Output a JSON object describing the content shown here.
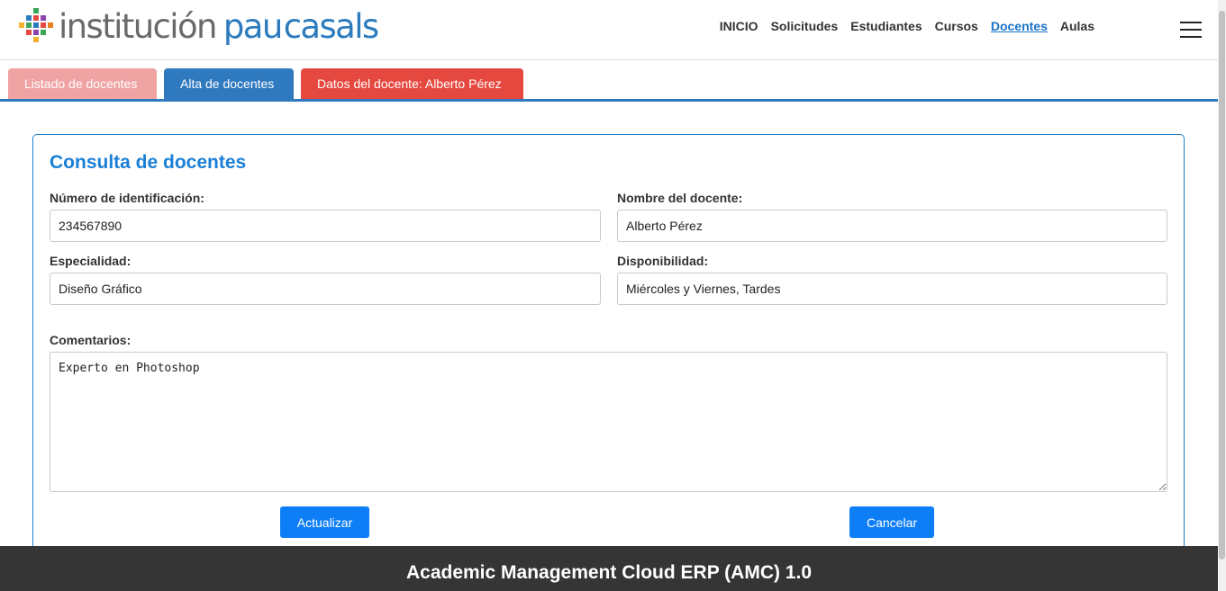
{
  "brand": {
    "word1": "institución",
    "word2": "pau",
    "word3": "casals",
    "mark_colors": [
      "#e5483f",
      "#f2b230",
      "#3aa757",
      "#2b7bbd",
      "#8e44ad",
      "#e67e22"
    ]
  },
  "nav": {
    "items": [
      {
        "label": "INICIO"
      },
      {
        "label": "Solicitudes"
      },
      {
        "label": "Estudiantes"
      },
      {
        "label": "Cursos"
      },
      {
        "label": "Docentes",
        "active": true
      },
      {
        "label": "Aulas"
      }
    ],
    "menu_icon": "hamburger-icon"
  },
  "tabs": [
    {
      "label": "Listado de docentes"
    },
    {
      "label": "Alta de docentes"
    },
    {
      "label": "Datos del docente: Alberto Pérez"
    }
  ],
  "form": {
    "title": "Consulta de docentes",
    "id_label": "Número de identificación:",
    "id_value": "234567890",
    "name_label": "Nombre del docente:",
    "name_value": "Alberto Pérez",
    "specialty_label": "Especialidad:",
    "specialty_value": "Diseño Gráfico",
    "availability_label": "Disponibilidad:",
    "availability_value": "Miércoles y Viernes, Tardes",
    "comments_label": "Comentarios:",
    "comments_value": "Experto en Photoshop",
    "update_button": "Actualizar",
    "cancel_button": "Cancelar"
  },
  "footer": {
    "text": "Academic Management Cloud ERP (AMC) 1.0"
  },
  "colors": {
    "accent": "#1a7fd6",
    "tab_blue": "#2f79bf",
    "tab_red": "#e5483f",
    "tab_pink": "#f0a3a3",
    "button": "#0d7ef6",
    "footer": "#353535"
  }
}
